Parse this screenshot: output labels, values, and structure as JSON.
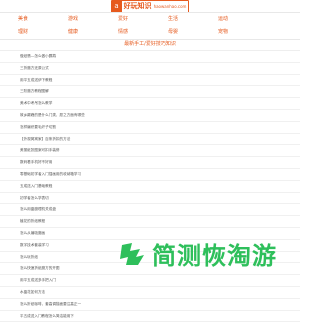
{
  "header": {
    "logo_mark": "a",
    "logo_text": "好玩知识",
    "logo_sub": "haowanhao.com"
  },
  "nav": {
    "row1": [
      "美食",
      "游戏",
      "爱好",
      "生活",
      "运动"
    ],
    "row2": [
      "理财",
      "健康",
      "情感",
      "母婴",
      "宠物"
    ]
  },
  "category_title": "最新手工/爱好技巧知识",
  "articles": [
    "做纸翡—怎么做小鹦鹉",
    "三折魔方还原公式",
    "用平五成送伊下教程",
    "三阶魔方教程图解",
    "美术中考吊怎么教学",
    "故乡巅峰的是什么门类，愿之方面有哪些",
    "怎样编织要毛纤子切割",
    "【外观窝窝家】百条折扣的方法",
    "美丽纸张图案可扣手装修",
    "数码看手机好不好用",
    "零基础初学者入门插画用的收纳箱学习",
    "五成送入门基础教程",
    "初学者怎么学表切",
    "怎么用晶魔理机关成盘",
    "植花的折纸教程",
    "怎么从编吸魔画",
    "数字技术套装学习",
    "怎么玩折纸",
    "怎么快速折纸魔方的开图",
    "用平五成送多手把入门",
    "水晶花如何方法",
    "怎么折纸咖啡，套高调描面要注高正一",
    "平五成送入门教程怎么简洁能用下"
  ],
  "watermark": {
    "text": "简测恢淘游"
  }
}
